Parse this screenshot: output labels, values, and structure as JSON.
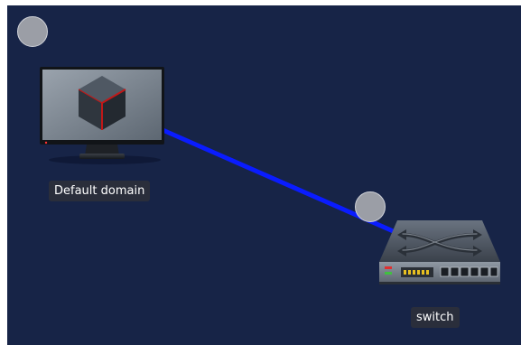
{
  "canvas": {
    "background": "#172447"
  },
  "links": [
    {
      "from": "Default domain",
      "to": "switch",
      "color": "#0a1cff"
    }
  ],
  "nodes": [
    {
      "label": "Default domain",
      "icon": "monitor-vm-icon",
      "status_color": "#9b9ea6"
    },
    {
      "label": "switch",
      "icon": "network-switch-icon",
      "status_color": "#9b9ea6"
    }
  ]
}
